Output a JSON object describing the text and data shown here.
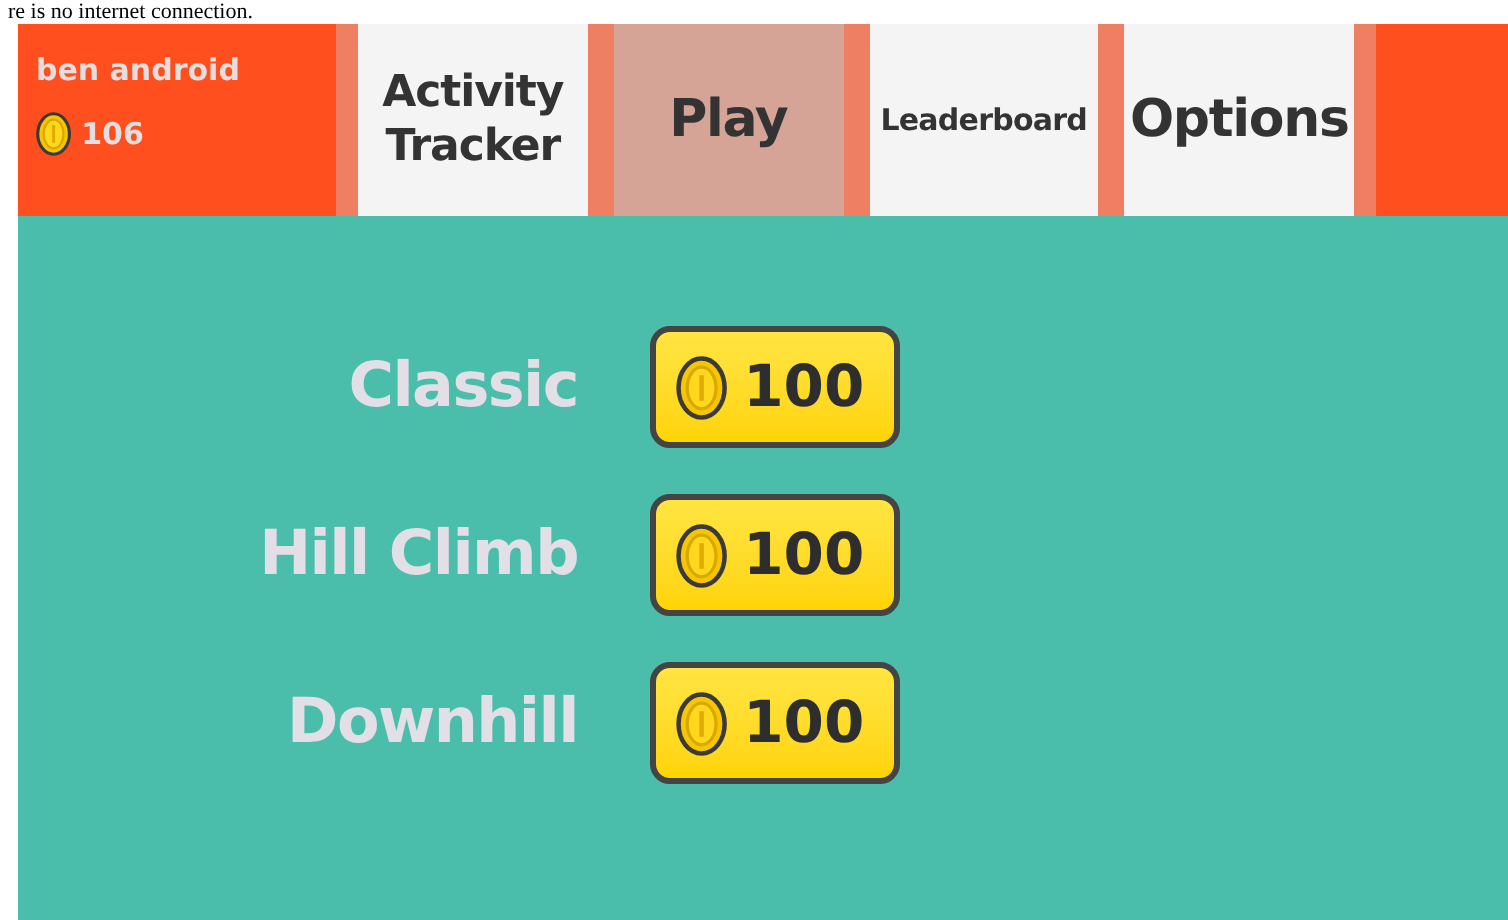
{
  "banner": {
    "message": "re is no internet connection."
  },
  "user": {
    "name": "ben android",
    "coins": "106"
  },
  "tabs": [
    {
      "label": "Activity Tracker",
      "selected": false
    },
    {
      "label": "Play",
      "selected": true
    },
    {
      "label": "Leaderboard",
      "selected": false
    },
    {
      "label": "Options",
      "selected": false
    }
  ],
  "modes": [
    {
      "name": "Classic",
      "cost": "100"
    },
    {
      "name": "Hill Climb",
      "cost": "100"
    },
    {
      "name": "Downhill",
      "cost": "100"
    }
  ]
}
